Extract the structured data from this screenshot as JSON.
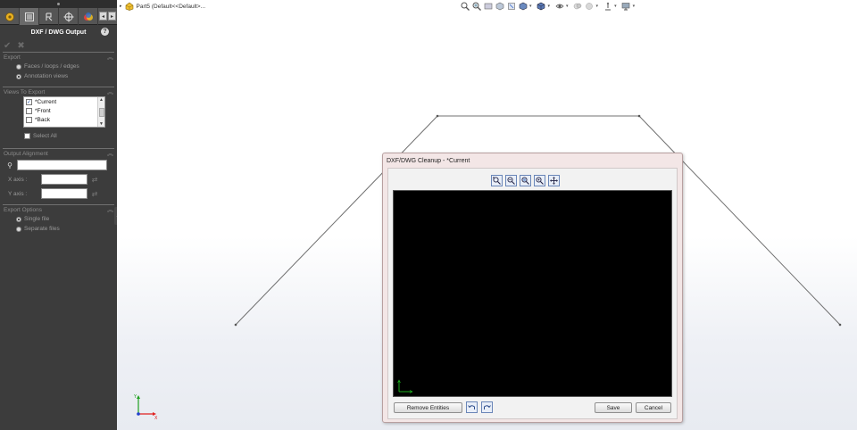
{
  "property_manager": {
    "title": "DXF / DWG Output",
    "sections": {
      "export": {
        "header": "Export",
        "options": [
          "Faces / loops / edges",
          "Annotation views"
        ],
        "selected": "Annotation views"
      },
      "views_to_export": {
        "header": "Views To Export",
        "items": [
          {
            "label": "*Current",
            "checked": true
          },
          {
            "label": "*Front",
            "checked": false
          },
          {
            "label": "*Back",
            "checked": false
          }
        ],
        "select_all_label": "Select All"
      },
      "output_alignment": {
        "header": "Output Alignment",
        "x_axis_label": "X axis :",
        "y_axis_label": "Y axis :"
      },
      "export_options": {
        "header": "Export Options",
        "options": [
          "Single file",
          "Separate files"
        ],
        "selected": "Single file"
      }
    }
  },
  "graphics": {
    "tree_flyout_label": "Part5  (Default<<Default>..."
  },
  "dialog": {
    "title": "DXF/DWG Cleanup - *Current",
    "remove_entities_label": "Remove Entities",
    "save_label": "Save",
    "cancel_label": "Cancel"
  },
  "colors": {
    "panel_bg": "#3c3c3c",
    "dialog_bg": "#f3e6e6",
    "preview_bg": "#000000",
    "triad_x": "#e02020",
    "triad_y": "#20a020",
    "triad_z": "#2040d0"
  }
}
